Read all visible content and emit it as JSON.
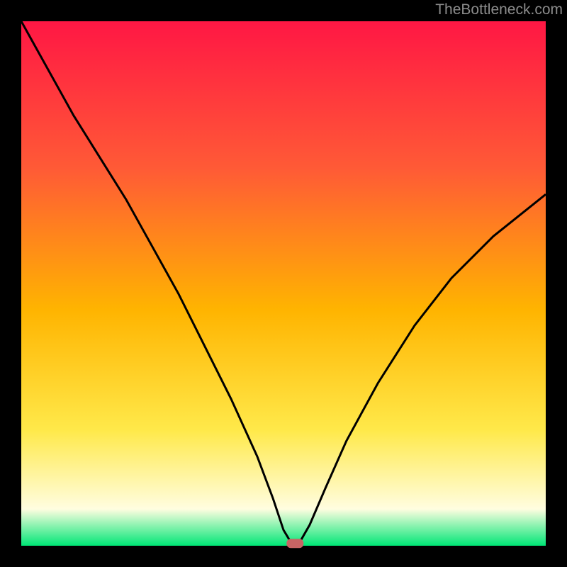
{
  "watermark": "TheBottleneck.com",
  "colors": {
    "gradient_top": "#ff1744",
    "gradient_upper": "#ff5a36",
    "gradient_mid": "#ffb400",
    "gradient_lower": "#ffe94a",
    "gradient_pale": "#fffde0",
    "gradient_bottom": "#00e676",
    "curve": "#000000",
    "marker": "#c86464",
    "frame": "#000000"
  },
  "chart_data": {
    "type": "line",
    "title": "",
    "xlabel": "",
    "ylabel": "",
    "xlim": [
      0,
      100
    ],
    "ylim": [
      0,
      100
    ],
    "series": [
      {
        "name": "bottleneck-curve",
        "x": [
          0,
          5,
          10,
          15,
          20,
          25,
          30,
          35,
          40,
          45,
          48,
          50,
          51.5,
          53,
          55,
          58,
          62,
          68,
          75,
          82,
          90,
          100
        ],
        "values": [
          100,
          91,
          82,
          74,
          66,
          57,
          48,
          38,
          28,
          17,
          9,
          3,
          0.5,
          0.5,
          4,
          11,
          20,
          31,
          42,
          51,
          59,
          67
        ]
      }
    ],
    "marker": {
      "x": 52.2,
      "y": 0.5,
      "name": "optimal-point"
    }
  }
}
